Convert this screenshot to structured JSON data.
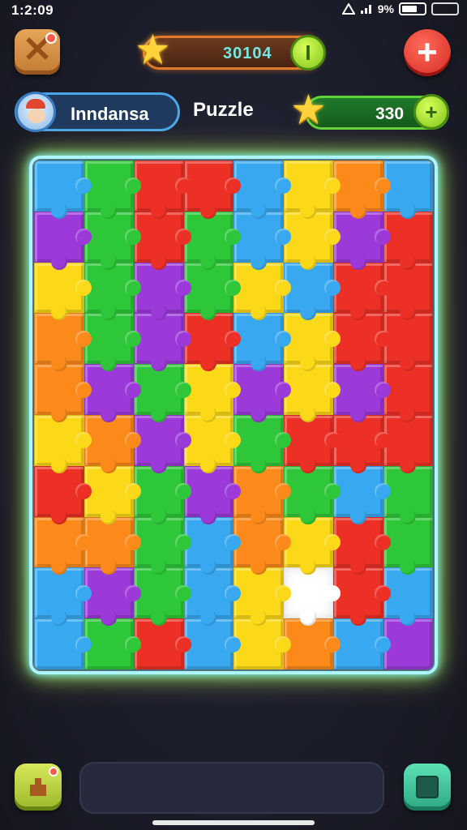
{
  "status_bar": {
    "time": "1:2:09",
    "battery": "9%",
    "icons": [
      "signal-icon",
      "wifi-icon",
      "battery-icon"
    ]
  },
  "top_bar": {
    "close_icon": "close-icon",
    "score_value": "30104",
    "score_coin_label": "I",
    "add_icon": "plus-icon"
  },
  "player": {
    "name": "Inndansa",
    "avatar": "avatar-icon"
  },
  "mode_label": "Puzzle",
  "coins": {
    "value": "330",
    "add_label": "+"
  },
  "board": {
    "rows": 10,
    "cols": 8,
    "palette": {
      "B": "#38a8f0",
      "G": "#2fc73a",
      "R": "#ec3026",
      "Y": "#fbd818",
      "O": "#fb8a1a",
      "P": "#9b3ad8",
      "W": "#ffffff"
    },
    "pieces": [
      "BGRRBYOB",
      "PGRGBYPR",
      "YGPGYBRR",
      "OGPRBYRR",
      "OPGYPYPR",
      "YOPYGRRR",
      "RYGPOGBG",
      "OOGBOYRG",
      "BPGBYWRB",
      "BGRBYOBP"
    ]
  },
  "bottom_bar": {
    "left_icon": "hint-icon",
    "right_icon": "menu-square-icon"
  }
}
